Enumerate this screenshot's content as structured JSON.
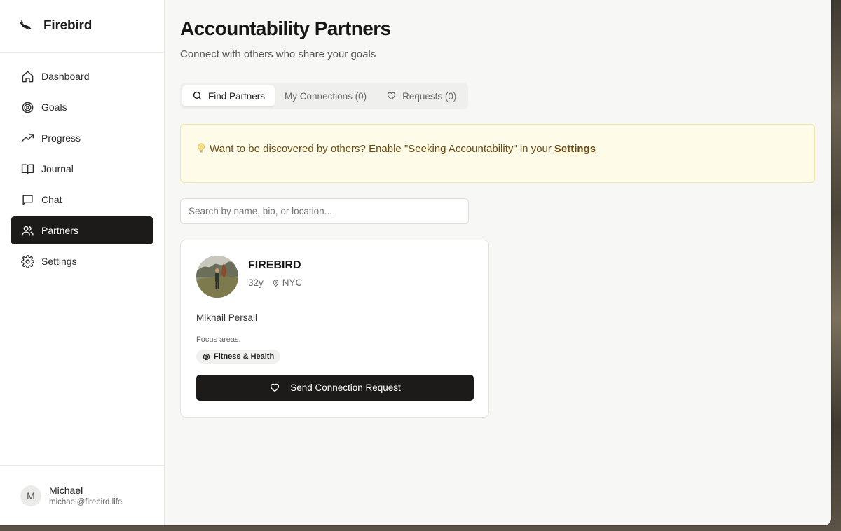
{
  "app": {
    "name": "Firebird",
    "logo_icon": "firebird-bird-icon"
  },
  "sidebar": {
    "items": [
      {
        "label": "Dashboard",
        "icon": "home-icon",
        "active": false
      },
      {
        "label": "Goals",
        "icon": "target-icon",
        "active": false
      },
      {
        "label": "Progress",
        "icon": "trending-up-icon",
        "active": false
      },
      {
        "label": "Journal",
        "icon": "book-open-icon",
        "active": false
      },
      {
        "label": "Chat",
        "icon": "message-square-icon",
        "active": false
      },
      {
        "label": "Partners",
        "icon": "users-icon",
        "active": true
      },
      {
        "label": "Settings",
        "icon": "gear-icon",
        "active": false
      }
    ],
    "user": {
      "initial": "M",
      "name": "Michael",
      "email": "michael@firebird.life"
    }
  },
  "page": {
    "title": "Accountability Partners",
    "subtitle": "Connect with others who share your goals"
  },
  "tabs": [
    {
      "label": "Find Partners",
      "icon": "search-icon",
      "active": true
    },
    {
      "label": "My Connections (0)",
      "icon": "",
      "active": false
    },
    {
      "label": "Requests (0)",
      "icon": "heart-icon",
      "active": false
    }
  ],
  "notice": {
    "icon": "lightbulb-icon",
    "text": "Want to be discovered by others? Enable \"Seeking Accountability\" in your",
    "link_label": "Settings"
  },
  "search": {
    "placeholder": "Search by name, bio, or location...",
    "value": ""
  },
  "partner_card": {
    "name": "FIREBIRD",
    "age": "32y",
    "location": "NYC",
    "bio": "Mikhail Persail",
    "focus_label": "Focus areas:",
    "focus_areas": [
      "Fitness & Health"
    ],
    "cta_label": "Send Connection Request"
  },
  "colors": {
    "accent_dark": "#1c1b1a",
    "notice_bg": "#fefbe8",
    "notice_border": "#f4e4a6",
    "notice_text": "#6b4a12"
  }
}
